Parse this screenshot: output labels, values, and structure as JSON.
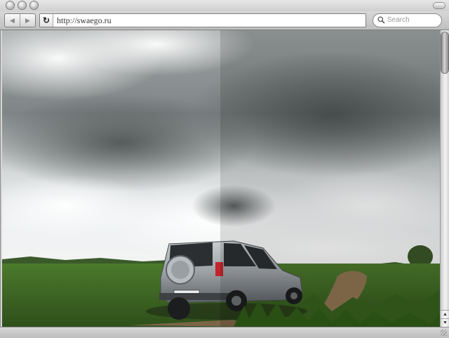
{
  "window": {
    "title": ""
  },
  "toolbar": {
    "back_icon": "back-arrow-icon",
    "forward_icon": "forward-arrow-icon",
    "reload_icon": "reload-icon",
    "url": "http://swaego.ru",
    "search": {
      "placeholder": "Search",
      "value": ""
    }
  },
  "content": {
    "image_description_subject": "silver SUV on a dirt road under a cloudy sky",
    "split_overlay": "right half darkened"
  },
  "colors": {
    "chrome": "#d6d6d6",
    "sky_light": "#e8ebee",
    "sky_dark": "#6f7373",
    "grass": "#3f6a25"
  }
}
